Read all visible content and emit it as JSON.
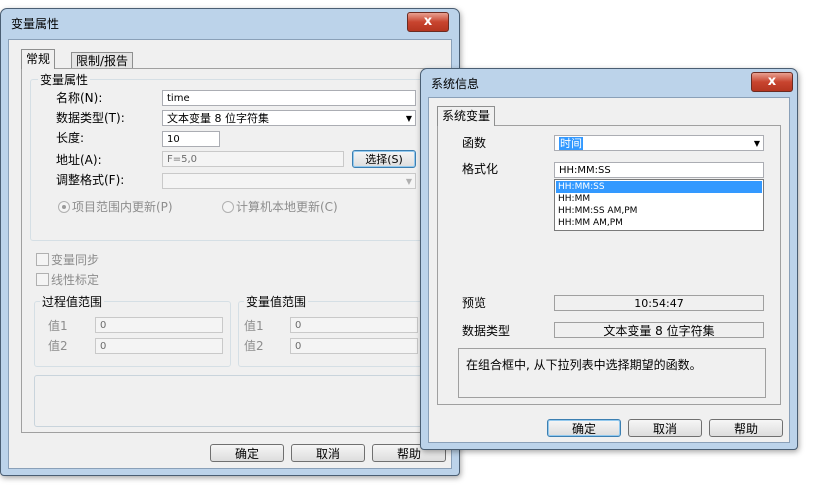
{
  "var_dialog": {
    "title": "变量属性",
    "close_label": "x",
    "tabs": [
      "常规",
      "限制/报告"
    ],
    "group_var_props": "变量属性",
    "name_label": "名称(N):",
    "name_value": "time",
    "datatype_label": "数据类型(T):",
    "datatype_value": "文本变量 8 位字符集",
    "length_label": "长度:",
    "length_value": "10",
    "address_label": "地址(A):",
    "address_value": "F=5,0",
    "select_button": "选择(S)",
    "adjust_format_label": "调整格式(F):",
    "adjust_format_value": "",
    "radio_project": "项目范围内更新(P)",
    "radio_local": "计算机本地更新(C)",
    "check_sync": "变量同步",
    "check_linear": "线性标定",
    "group_process_range": "过程值范围",
    "group_var_range": "变量值范围",
    "value1_label": "值1",
    "value2_label": "值2",
    "proc_value1": "0",
    "proc_value2": "0",
    "var_value1": "0",
    "var_value2": "0",
    "ok_button": "确定",
    "cancel_button": "取消",
    "help_button": "帮助"
  },
  "sys_dialog": {
    "title": "系统信息",
    "close_label": "x",
    "tab": "系统变量",
    "function_label": "函数",
    "function_value": "时间",
    "format_label": "格式化",
    "format_value": "HH:MM:SS",
    "format_options": [
      "HH:MM:SS",
      "HH:MM",
      "HH:MM:SS AM,PM",
      "HH:MM AM,PM"
    ],
    "preview_label": "预览",
    "preview_value": "10:54:47",
    "datatype_label": "数据类型",
    "datatype_value": "文本变量 8 位字符集",
    "hint_text": "在组合框中, 从下拉列表中选择期望的函数。",
    "ok_button": "确定",
    "cancel_button": "取消",
    "help_button": "帮助"
  },
  "colors": {
    "frame": "#bcd3ea",
    "selection": "#3399ff",
    "close_red": "#c8442f"
  }
}
